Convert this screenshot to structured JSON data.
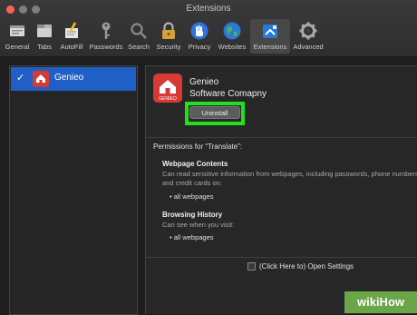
{
  "window": {
    "title": "Extensions"
  },
  "toolbar": {
    "items": [
      {
        "label": "General",
        "icon": "general-icon"
      },
      {
        "label": "Tabs",
        "icon": "tabs-icon"
      },
      {
        "label": "AutoFill",
        "icon": "autofill-icon"
      },
      {
        "label": "Passwords",
        "icon": "key-icon"
      },
      {
        "label": "Search",
        "icon": "magnifier-icon"
      },
      {
        "label": "Security",
        "icon": "lock-icon"
      },
      {
        "label": "Privacy",
        "icon": "hand-icon"
      },
      {
        "label": "Websites",
        "icon": "globe-icon"
      },
      {
        "label": "Extensions",
        "icon": "puzzle-icon"
      },
      {
        "label": "Advanced",
        "icon": "gear-icon"
      }
    ],
    "active": "Extensions"
  },
  "extension_list": [
    {
      "name": "Genieo",
      "enabled": true,
      "selected": true
    }
  ],
  "detail": {
    "logo_text": "GENIEO",
    "name": "Genieo",
    "company": "Software Comapny",
    "uninstall_label": "Uninstall",
    "permissions_heading": "Permissions for “Translate”:",
    "sections": [
      {
        "title": "Webpage Contents",
        "desc": "Can read sensitive information from webpages, including passwords, phone numbers and credit cards on:",
        "scope": "all webpages"
      },
      {
        "title": "Browsing History",
        "desc": "Can see when you visit:",
        "scope": "all webpages"
      }
    ],
    "open_settings": "(Click Here to) Open Settings"
  },
  "watermark": "wikiHow",
  "colors": {
    "selection": "#1f5fc6",
    "highlight": "#22e01c",
    "logo": "#d53a36"
  }
}
